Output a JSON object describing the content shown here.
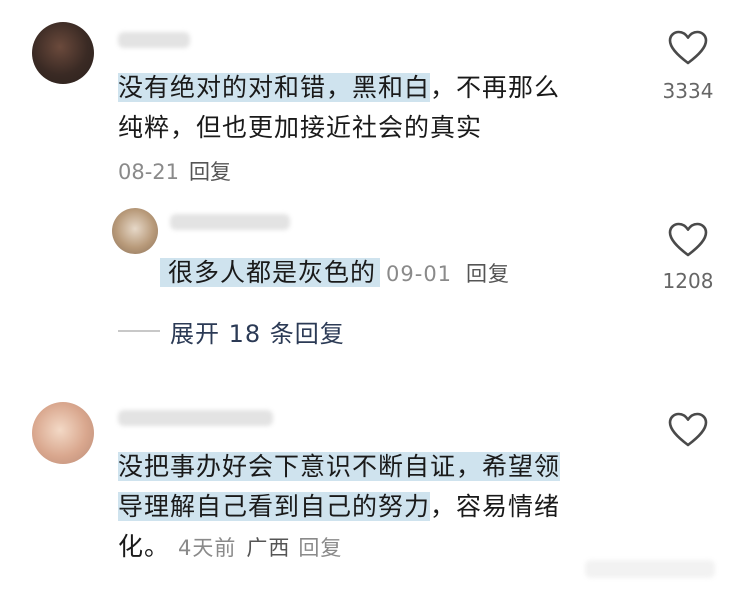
{
  "comments": [
    {
      "text_highlight": "没有绝对的对和错，黑和白",
      "text_line1_rest": "，不再那么",
      "text_line2": "纯粹，但也更加接近社会的真实",
      "date": "08-21",
      "reply_label": "回复",
      "likes": "3334"
    },
    {
      "text_highlight": "很多人都是灰色的",
      "date": "09-01",
      "reply_label": "回复",
      "likes": "1208"
    },
    {
      "text_line1": "没把事办好会下意识不断自证，希望领",
      "text_line2_highlight": "导理解自己看到自己的努力",
      "text_line2_rest": "，容易情绪",
      "text_line3": "化。",
      "date": "4天前",
      "location": "广西",
      "reply_label": "回复"
    }
  ],
  "expand_replies_label": "展开 18 条回复",
  "icons": {
    "like": "heart-outline-icon"
  }
}
